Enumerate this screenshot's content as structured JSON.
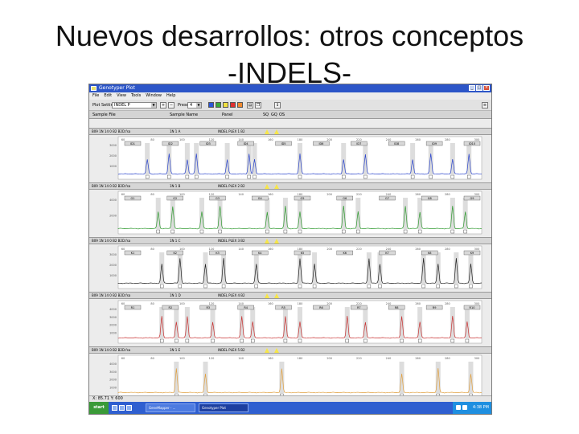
{
  "slide": {
    "title_line1": "Nuevos desarrollos: otros conceptos",
    "title_line2": "-INDELS-"
  },
  "window": {
    "title": "Genotyper Plot",
    "menu": [
      "File",
      "Edit",
      "View",
      "Tools",
      "Window",
      "Help"
    ],
    "toolbar": {
      "setting_label": "Plot Setting",
      "setting_value": "INDEL P",
      "preset_label": "Preset",
      "preset_value": "4",
      "swatches": [
        "#2a55d8",
        "#3aa83a",
        "#f0e040",
        "#e03030",
        "#f08a30"
      ]
    },
    "columns": [
      "Sample File",
      "Sample Name",
      "Panel",
      "SQ",
      "GQ",
      "OS"
    ],
    "panels": [
      {
        "file": "B09 1N 14 0 B2 B2D.fsa",
        "sample": "1N 1 A",
        "panel": "INDEL PLEX 1 B2",
        "color": "#2a44cc",
        "markers": [
          "ID1",
          "ID2",
          "ID3",
          "ID4",
          "ID5",
          "ID6",
          "ID7",
          "ID8",
          "ID9",
          "ID10"
        ],
        "yticks": [
          "3000",
          "2000",
          "1000"
        ],
        "peaks": [
          0.08,
          0.14,
          0.19,
          0.215,
          0.3,
          0.36,
          0.375,
          0.5,
          0.62,
          0.68,
          0.81,
          0.86,
          0.92,
          0.965
        ]
      },
      {
        "file": "B09 1N 14 0 B2 B2D.fsa",
        "sample": "1N 1 B",
        "panel": "INDEL PLEX 2 B2",
        "color": "#2f9a2f",
        "markers": [
          "G1",
          "G2",
          "G3",
          "G4",
          "G5",
          "G6",
          "G7",
          "G8",
          "G9"
        ],
        "yticks": [
          "4000",
          "2000"
        ],
        "peaks": [
          0.11,
          0.15,
          0.23,
          0.28,
          0.41,
          0.46,
          0.5,
          0.62,
          0.66,
          0.79,
          0.83,
          0.92,
          0.955
        ]
      },
      {
        "file": "B09 1N 14 0 B2 B2D.fsa",
        "sample": "1N 1 C",
        "panel": "INDEL PLEX 3 B2",
        "color": "#222222",
        "markers": [
          "K1",
          "K2",
          "K3",
          "K4",
          "K5",
          "K6",
          "K7",
          "K8",
          "K9"
        ],
        "yticks": [
          "3000",
          "2000",
          "1000"
        ],
        "peaks": [
          0.12,
          0.17,
          0.24,
          0.29,
          0.38,
          0.5,
          0.54,
          0.69,
          0.72,
          0.84,
          0.88,
          0.93,
          0.97
        ]
      },
      {
        "file": "B09 1N 14 0 B2 B2D.fsa",
        "sample": "1N 1 D",
        "panel": "INDEL PLEX 4 B2",
        "color": "#c83030",
        "markers": [
          "R1",
          "R2",
          "R3",
          "R4",
          "R5",
          "R6",
          "R7",
          "R8",
          "R9",
          "R10"
        ],
        "yticks": [
          "4000",
          "3000",
          "2000",
          "1000"
        ],
        "peaks": [
          0.12,
          0.16,
          0.19,
          0.26,
          0.34,
          0.37,
          0.46,
          0.5,
          0.63,
          0.68,
          0.78,
          0.83,
          0.92,
          0.96
        ]
      },
      {
        "file": "B09 1N 14 0 B2 B2D.fsa",
        "sample": "1N 1 E",
        "panel": "INDEL PLEX 5 B2",
        "color": "#e0a040",
        "markers": [],
        "yticks": [
          "4000",
          "3000",
          "2000",
          "1000"
        ],
        "peaks": [
          0.16,
          0.24,
          0.45,
          0.78,
          0.88,
          0.97
        ]
      }
    ],
    "xticks": [
      "60",
      "80",
      "100",
      "120",
      "140",
      "160",
      "180",
      "200",
      "220",
      "240",
      "260",
      "280",
      "300"
    ],
    "status": "X: 85.71  Y: 600",
    "taskbar": {
      "start": "start",
      "buttons": [
        "GeneMapper - ...",
        "Genotyper Plot"
      ],
      "clock": "4:38 PM"
    }
  }
}
